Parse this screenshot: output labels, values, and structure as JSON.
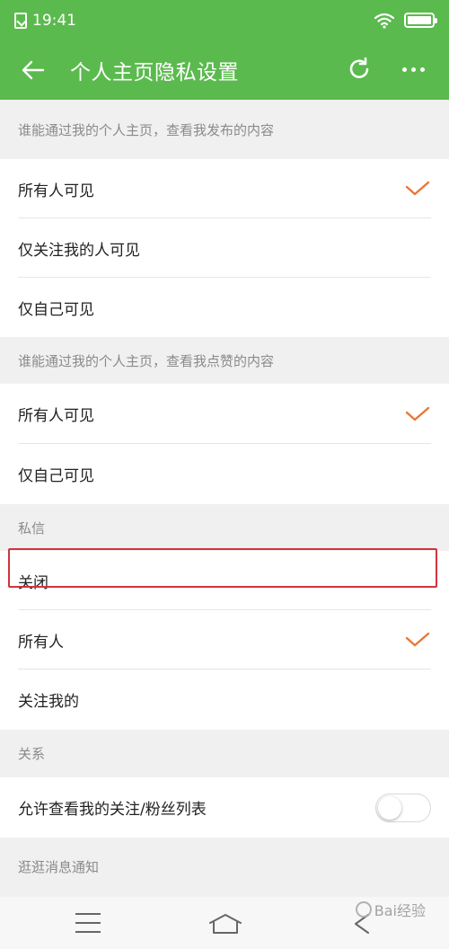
{
  "status_bar": {
    "time": "19:41"
  },
  "header": {
    "title": "个人主页隐私设置"
  },
  "sections": {
    "posts": {
      "header": "谁能通过我的个人主页，查看我发布的内容",
      "options": [
        "所有人可见",
        "仅关注我的人可见",
        "仅自己可见"
      ],
      "selected": "所有人可见"
    },
    "likes": {
      "header": "谁能通过我的个人主页，查看我点赞的内容",
      "options": [
        "所有人可见",
        "仅自己可见"
      ],
      "selected": "所有人可见"
    },
    "messages": {
      "header": "私信",
      "options": [
        "关闭",
        "所有人",
        "关注我的"
      ],
      "selected": "所有人"
    },
    "relations": {
      "header": "关系",
      "toggle_label": "允许查看我的关注/粉丝列表",
      "toggle_on": false
    },
    "notifications": {
      "header": "逛逛消息通知"
    }
  },
  "watermark": "Bai经验",
  "colors": {
    "accent": "#5bba4e",
    "check": "#e8783a",
    "highlight": "#d0343e"
  }
}
